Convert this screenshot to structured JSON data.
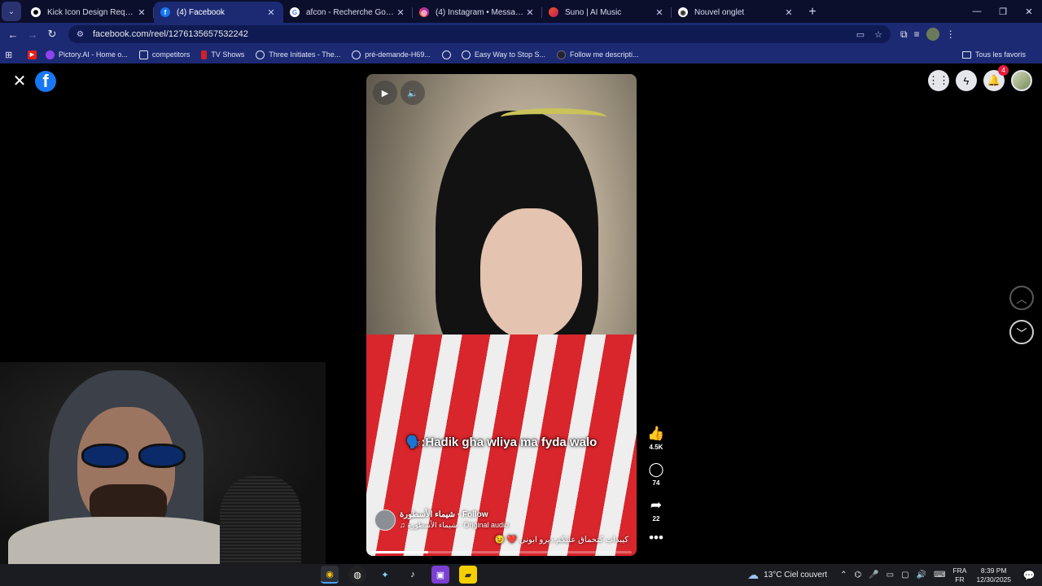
{
  "browser": {
    "tabs": [
      {
        "title": "Kick Icon Design Request",
        "favicon": "openai-icon",
        "active": false
      },
      {
        "title": "(4) Facebook",
        "favicon": "facebook-icon",
        "active": true
      },
      {
        "title": "afcon - Recherche Google",
        "favicon": "google-icon",
        "active": false
      },
      {
        "title": "(4) Instagram • Messages",
        "favicon": "instagram-icon",
        "active": false
      },
      {
        "title": "Suno | AI Music",
        "favicon": "suno-icon",
        "active": false
      },
      {
        "title": "Nouvel onglet",
        "favicon": "chrome-icon",
        "active": false
      }
    ],
    "url": "facebook.com/reel/1276135657532242",
    "bookmarks": [
      {
        "label": "",
        "icon": "youtube-icon"
      },
      {
        "label": "Pictory.AI - Home o...",
        "icon": "pictory-icon"
      },
      {
        "label": "competitors",
        "icon": "folder-icon"
      },
      {
        "label": "TV Shows",
        "icon": "bookmark-red-icon"
      },
      {
        "label": "Three Initiates - The...",
        "icon": "globe-icon"
      },
      {
        "label": "pré-demande-H69...",
        "icon": "globe-icon"
      },
      {
        "label": "",
        "icon": "globe-icon"
      },
      {
        "label": "Easy Way to Stop S...",
        "icon": "globe-icon"
      },
      {
        "label": "Follow me descripti...",
        "icon": "site-icon"
      }
    ],
    "all_bookmarks": "Tous les favoris"
  },
  "facebook": {
    "notification_count": "4",
    "reel": {
      "caption": "🗣️:Hadik gha wliya ma fyda walo",
      "author": "شيماء الأسطورة",
      "follow": "Follow",
      "audio": "♫ شيماء الأسطورة · Original audio",
      "description": "كيبدات كتحماق عليكم ديرو ابوني ❤️ 😉",
      "progress": 0.22
    },
    "actions": [
      {
        "name": "like",
        "icon": "👍",
        "count": "4.5K"
      },
      {
        "name": "comment",
        "icon": "💬",
        "count": "74"
      },
      {
        "name": "share",
        "icon": "➦",
        "count": "22"
      }
    ]
  },
  "taskbar": {
    "weather": "13°C  Ciel couvert",
    "lang_top": "FRA",
    "lang_bottom": "FR",
    "time": "8:39 PM",
    "date": "12/30/2025"
  }
}
